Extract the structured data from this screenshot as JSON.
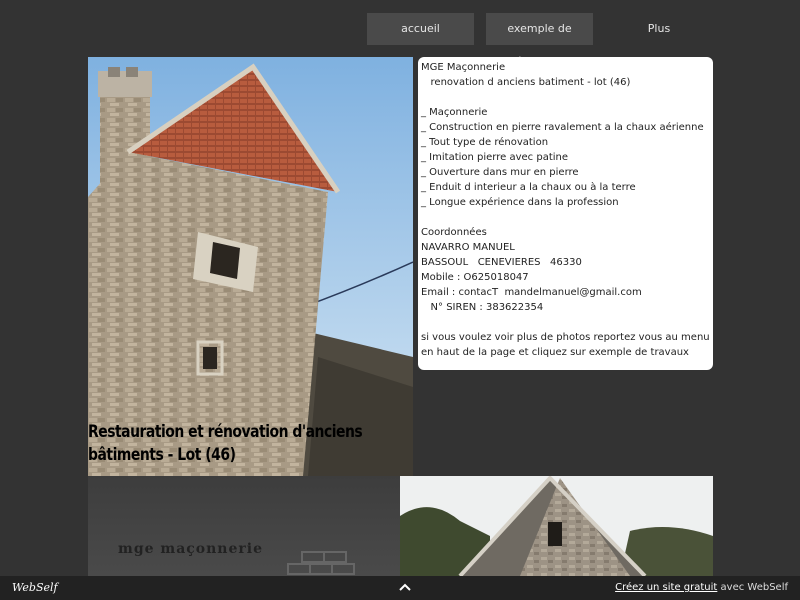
{
  "nav": {
    "items": [
      {
        "label": "accueil"
      },
      {
        "label": "exemple de travaux"
      },
      {
        "label": "Plus"
      }
    ]
  },
  "hero": {
    "caption": "Restauration et rénovation d'anciens bâtiments - Lot (46)"
  },
  "info": {
    "lines": [
      "MGE Maçonnerie",
      "   renovation d anciens batiment - lot (46)",
      "",
      "_ Maçonnerie",
      "_ Construction en pierre ravalement a la chaux aérienne",
      "_ Tout type de rénovation",
      "_ Imitation pierre avec patine",
      "_ Ouverture dans mur en pierre",
      "_ Enduit d interieur a la chaux ou à la terre",
      "_ Longue expérience dans la profession",
      "",
      "Coordonnées",
      "NAVARRO MANUEL",
      "BASSOUL   CENEVIERES   46330",
      "Mobile : O625018047",
      "Email : contacT  mandelmanuel@gmail.com",
      "   N° SIREN : 383622354",
      ""
    ],
    "note": "si vous voulez voir plus de photos reportez vous au menu en haut de la page et cliquez sur exemple de travaux"
  },
  "logo": {
    "text": "mge maçonnerie"
  },
  "footer": {
    "brand": "WebSelf",
    "link_text": "Créez un site gratuit",
    "suffix": " avec WebSelf",
    "icon": "chevron-up-icon"
  }
}
